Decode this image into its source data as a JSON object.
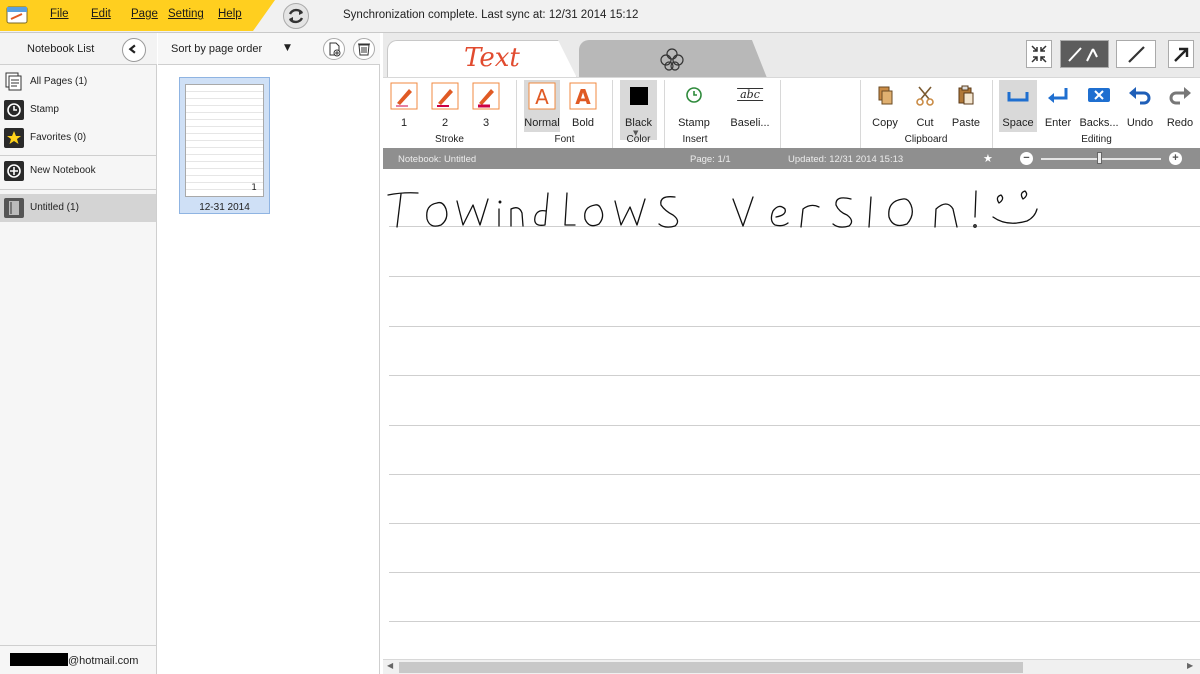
{
  "menu": {
    "file": "File",
    "edit": "Edit",
    "page": "Page",
    "setting": "Setting",
    "help": "Help"
  },
  "sync_message": "Synchronization complete. Last sync at:  12/31 2014 15:12",
  "sidebar": {
    "title": "Notebook List",
    "items": [
      {
        "label": "All Pages (1)",
        "icon": "pages-icon"
      },
      {
        "label": "Stamp",
        "icon": "clock-icon"
      },
      {
        "label": "Favorites (0)",
        "icon": "star-icon"
      },
      {
        "label": "New Notebook",
        "icon": "add-icon"
      },
      {
        "label": "Untitled (1)",
        "icon": "notebook-icon"
      }
    ],
    "account_suffix": "@hotmail.com"
  },
  "pagelist": {
    "sort_label": "Sort by page order",
    "thumb_number": "1",
    "thumb_date": "12-31 2014"
  },
  "tabs": {
    "text": "Text"
  },
  "ribbon": {
    "stroke": [
      "1",
      "2",
      "3"
    ],
    "stroke_group": "Stroke",
    "font": [
      "Normal",
      "Bold"
    ],
    "font_group": "Font",
    "color": "Black",
    "color_group": "Color",
    "stamp": "Stamp",
    "baseline": "Baseli...",
    "baseline_icon": "abc",
    "insert_group": "Insert",
    "clipboard": [
      "Copy",
      "Cut",
      "Paste"
    ],
    "clipboard_group": "Clipboard",
    "editing": [
      "Space",
      "Enter",
      "Backs...",
      "Undo",
      "Redo"
    ],
    "editing_group": "Editing"
  },
  "infobar": {
    "notebook": "Notebook: Untitled",
    "page": "Page: 1/1",
    "updated": "Updated: 12/31 2014 15:13"
  },
  "colors": {
    "accent": "#ffcf1f",
    "pen": "#e05a24",
    "tab_text": "#e14b2f"
  }
}
